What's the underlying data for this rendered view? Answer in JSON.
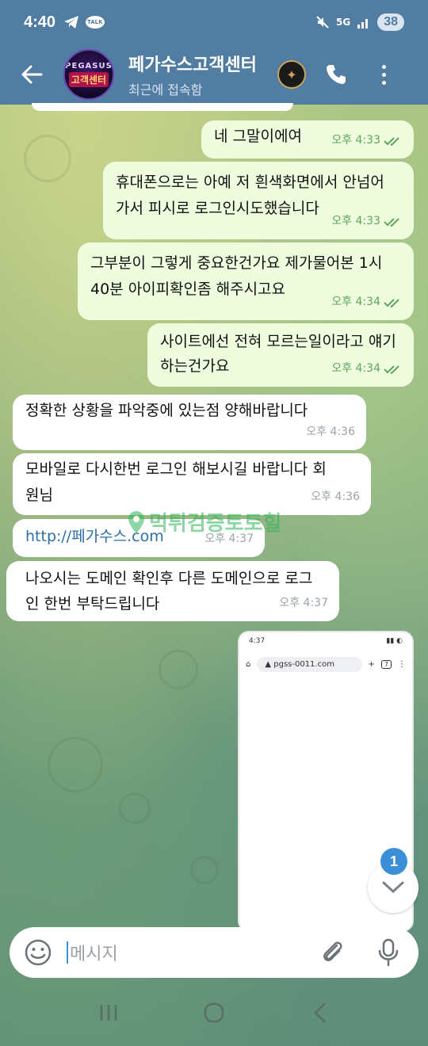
{
  "status_bar": {
    "time": "4:40",
    "talk_badge": "TALK",
    "network": "5G",
    "battery": "38"
  },
  "header": {
    "title": "페가수스고객센터",
    "status": "최근에 접속함",
    "avatar_top": "PEGASUS",
    "avatar_bottom": "고객센터"
  },
  "messages": [
    {
      "dir": "out",
      "text": "네 그말이에여",
      "time": "오후 4:33"
    },
    {
      "dir": "out",
      "text": "휴대폰으로는 아예 저 흰색화면에서 안넘어가서 피시로 로그인시도했습니다",
      "time": "오후 4:33"
    },
    {
      "dir": "out",
      "text": "그부분이 그렇게 중요한건가요 제가물어본 1시40분 아이피확인좀 해주시고요",
      "time": "오후 4:34"
    },
    {
      "dir": "out",
      "text": "사이트에선 전혀 모르는일이라고 얘기하는건가요",
      "time": "오후 4:34"
    },
    {
      "dir": "in",
      "text": "정확한 상황을 파악중에 있는점 양해바랍니다",
      "time": "오후 4:36"
    },
    {
      "dir": "in",
      "text": "모바일로 다시한번 로그인 해보시길 바랍니다 회원님",
      "time": "오후 4:36"
    },
    {
      "dir": "in",
      "text": "http://페가수스.com",
      "time": "오후 4:37"
    },
    {
      "dir": "in",
      "text": "나오시는 도메인 확인후 다른 도메인으로 로그인 한번 부탁드립니다",
      "time": "오후 4:37"
    }
  ],
  "image_message": {
    "status_time": "4:37",
    "url": "pgss-0011.com",
    "tab_count": "7"
  },
  "watermark": "먹튀검증토토힐",
  "scroll": {
    "unread": "1"
  },
  "input": {
    "placeholder": "메시지"
  },
  "colors": {
    "header_bg": "#517da2",
    "outgoing_bubble": "#effdde",
    "incoming_bubble": "#ffffff",
    "check_color": "#5fa55b",
    "link_color": "#2c6ea8",
    "badge_color": "#3a8fd8"
  }
}
